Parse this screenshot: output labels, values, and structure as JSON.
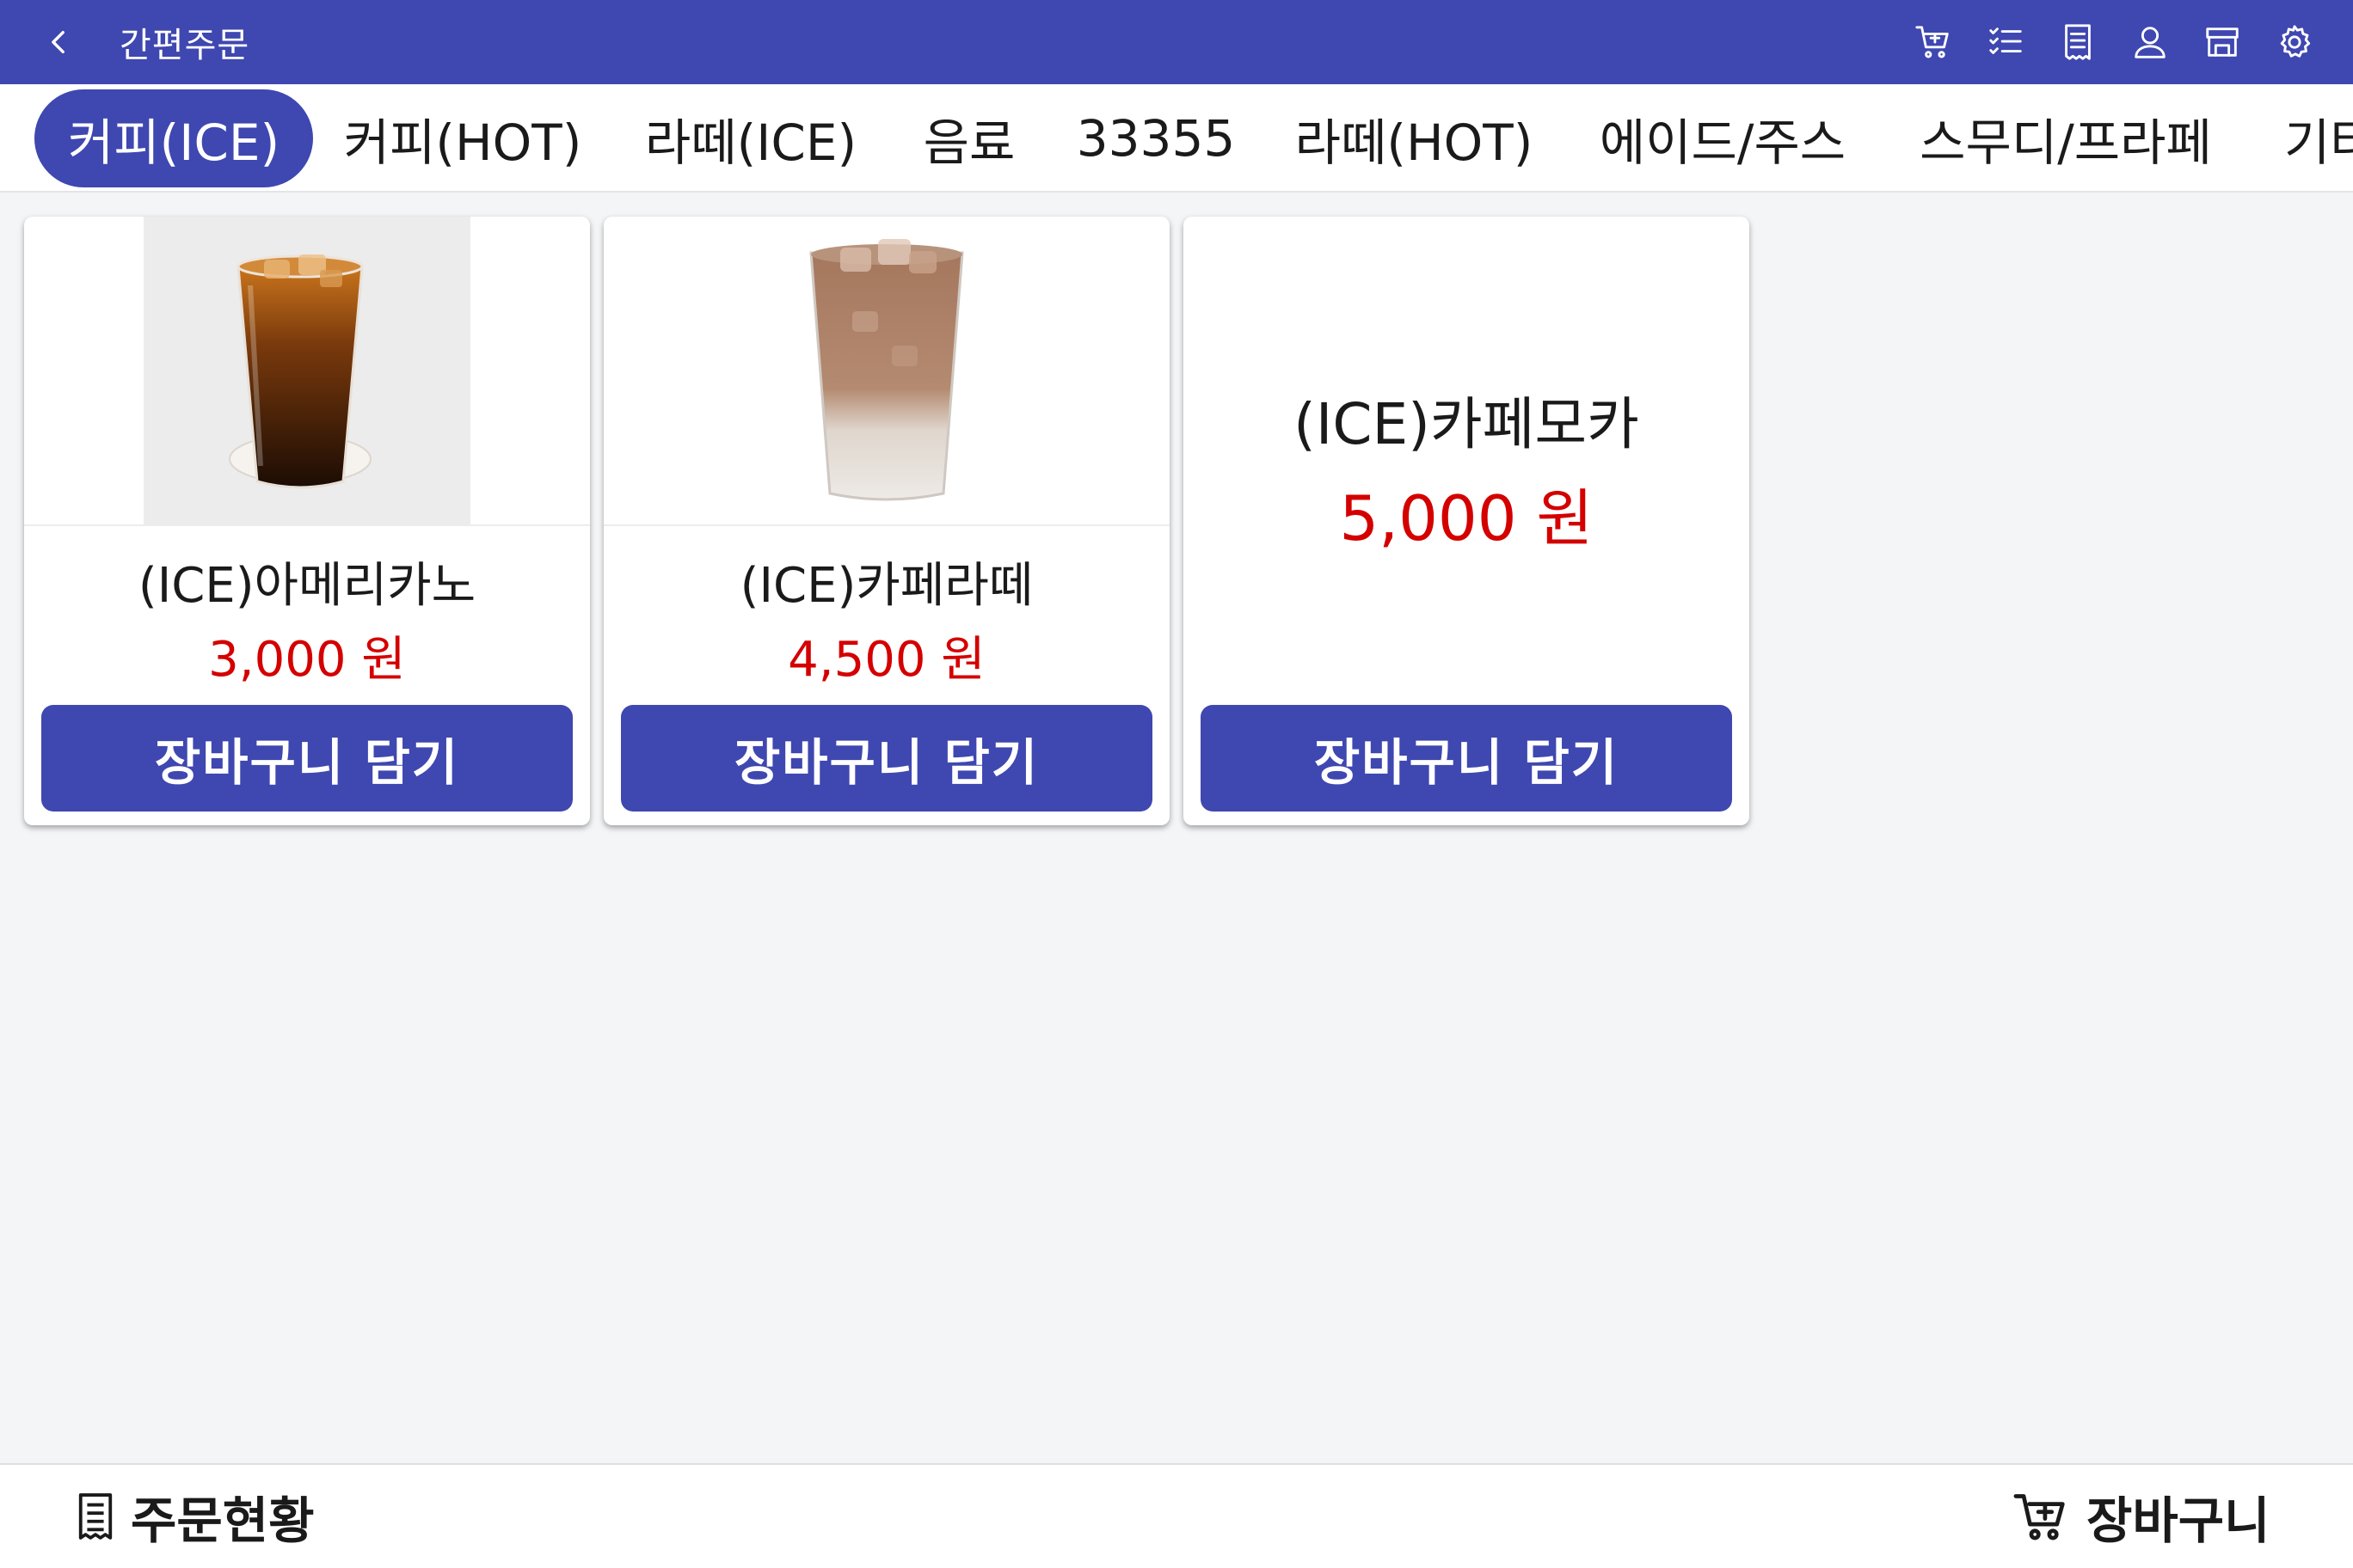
{
  "app": {
    "title": "간편주문"
  },
  "header_actions": [
    {
      "icon": "cart-icon"
    },
    {
      "icon": "checklist-icon"
    },
    {
      "icon": "receipt-icon"
    },
    {
      "icon": "user-icon"
    },
    {
      "icon": "store-icon"
    },
    {
      "icon": "settings-icon"
    }
  ],
  "tabs": [
    {
      "label": "커피(ICE)",
      "active": true
    },
    {
      "label": "커피(HOT)"
    },
    {
      "label": "라떼(ICE)"
    },
    {
      "label": "음료"
    },
    {
      "label": "33355"
    },
    {
      "label": "라떼(HOT)"
    },
    {
      "label": "에이드/주스"
    },
    {
      "label": "스무디/프라페"
    },
    {
      "label": "기타"
    }
  ],
  "products": [
    {
      "name": "(ICE)아메리카노",
      "price": "3,000 원",
      "has_image": true,
      "button": "장바구니 담기"
    },
    {
      "name": "(ICE)카페라떼",
      "price": "4,500 원",
      "has_image": true,
      "button": "장바구니 담기"
    },
    {
      "name": "(ICE)카페모카",
      "price": "5,000 원",
      "has_image": false,
      "button": "장바구니 담기"
    }
  ],
  "bottom": {
    "order_status": "주문현황",
    "cart": "장바구니"
  },
  "colors": {
    "primary": "#3f47b0",
    "price": "#d40000",
    "background": "#f4f5f7"
  }
}
